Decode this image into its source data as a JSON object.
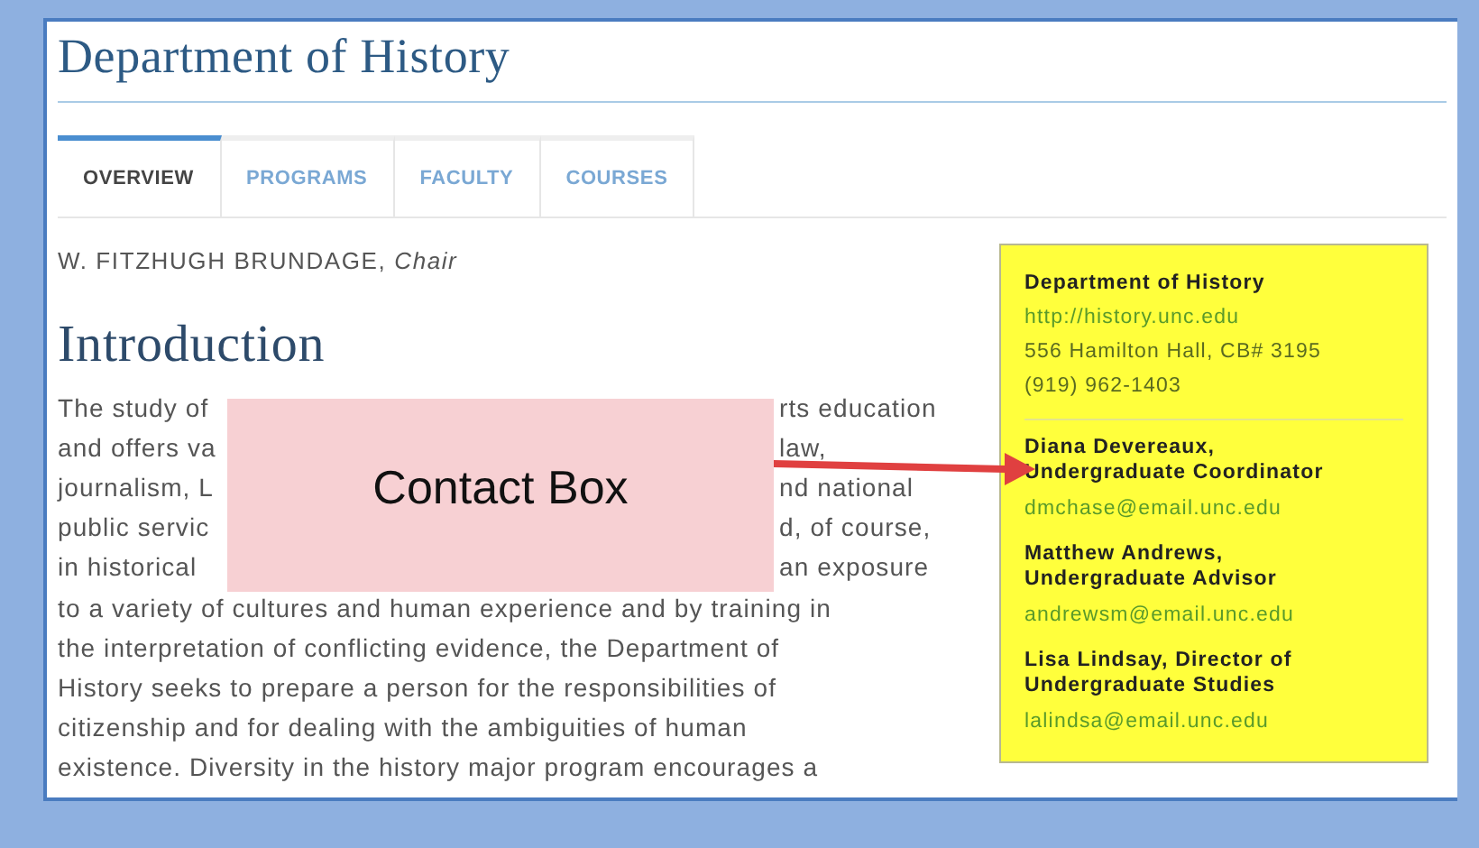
{
  "page": {
    "title": "Department of History"
  },
  "tabs": [
    {
      "label": "OVERVIEW",
      "selected": true
    },
    {
      "label": "PROGRAMS",
      "selected": false
    },
    {
      "label": "FACULTY",
      "selected": false
    },
    {
      "label": "COURSES",
      "selected": false
    }
  ],
  "chair": {
    "name": "W. FITZHUGH BRUNDAGE,",
    "role": "Chair"
  },
  "intro": {
    "heading": "Introduction",
    "lines": [
      {
        "left": "The study of",
        "right": "rts education"
      },
      {
        "left": "and offers va",
        "right": "law,"
      },
      {
        "left": "journalism, L",
        "right": "nd national"
      },
      {
        "left": "public servic",
        "right": "d, of course,"
      },
      {
        "left": "in historical",
        "right": "an exposure"
      },
      {
        "left": "to a variety of cultures and human experience and by training in"
      },
      {
        "left": "the interpretation of conflicting evidence, the Department of"
      },
      {
        "left": "History seeks to prepare a person for the responsibilities of"
      },
      {
        "left": "citizenship and for dealing with the ambiguities of human"
      },
      {
        "left": "existence. Diversity in the history major program encourages a"
      }
    ]
  },
  "contact_box": {
    "heading": "Department of History",
    "url": "http://history.unc.edu",
    "address": "556 Hamilton Hall, CB# 3195",
    "phone": "(919) 962-1403",
    "contacts": [
      {
        "title_lines": [
          "Diana Devereaux,",
          "Undergraduate Coordinator"
        ],
        "email": "dmchase@email.unc.edu"
      },
      {
        "title_lines": [
          "Matthew Andrews,",
          "Undergraduate Advisor"
        ],
        "email": "andrewsm@email.unc.edu"
      },
      {
        "title_lines": [
          "Lisa Lindsay, Director of",
          "Undergraduate Studies"
        ],
        "email": "lalindsa@email.unc.edu"
      }
    ]
  },
  "callout": {
    "label": "Contact Box"
  }
}
